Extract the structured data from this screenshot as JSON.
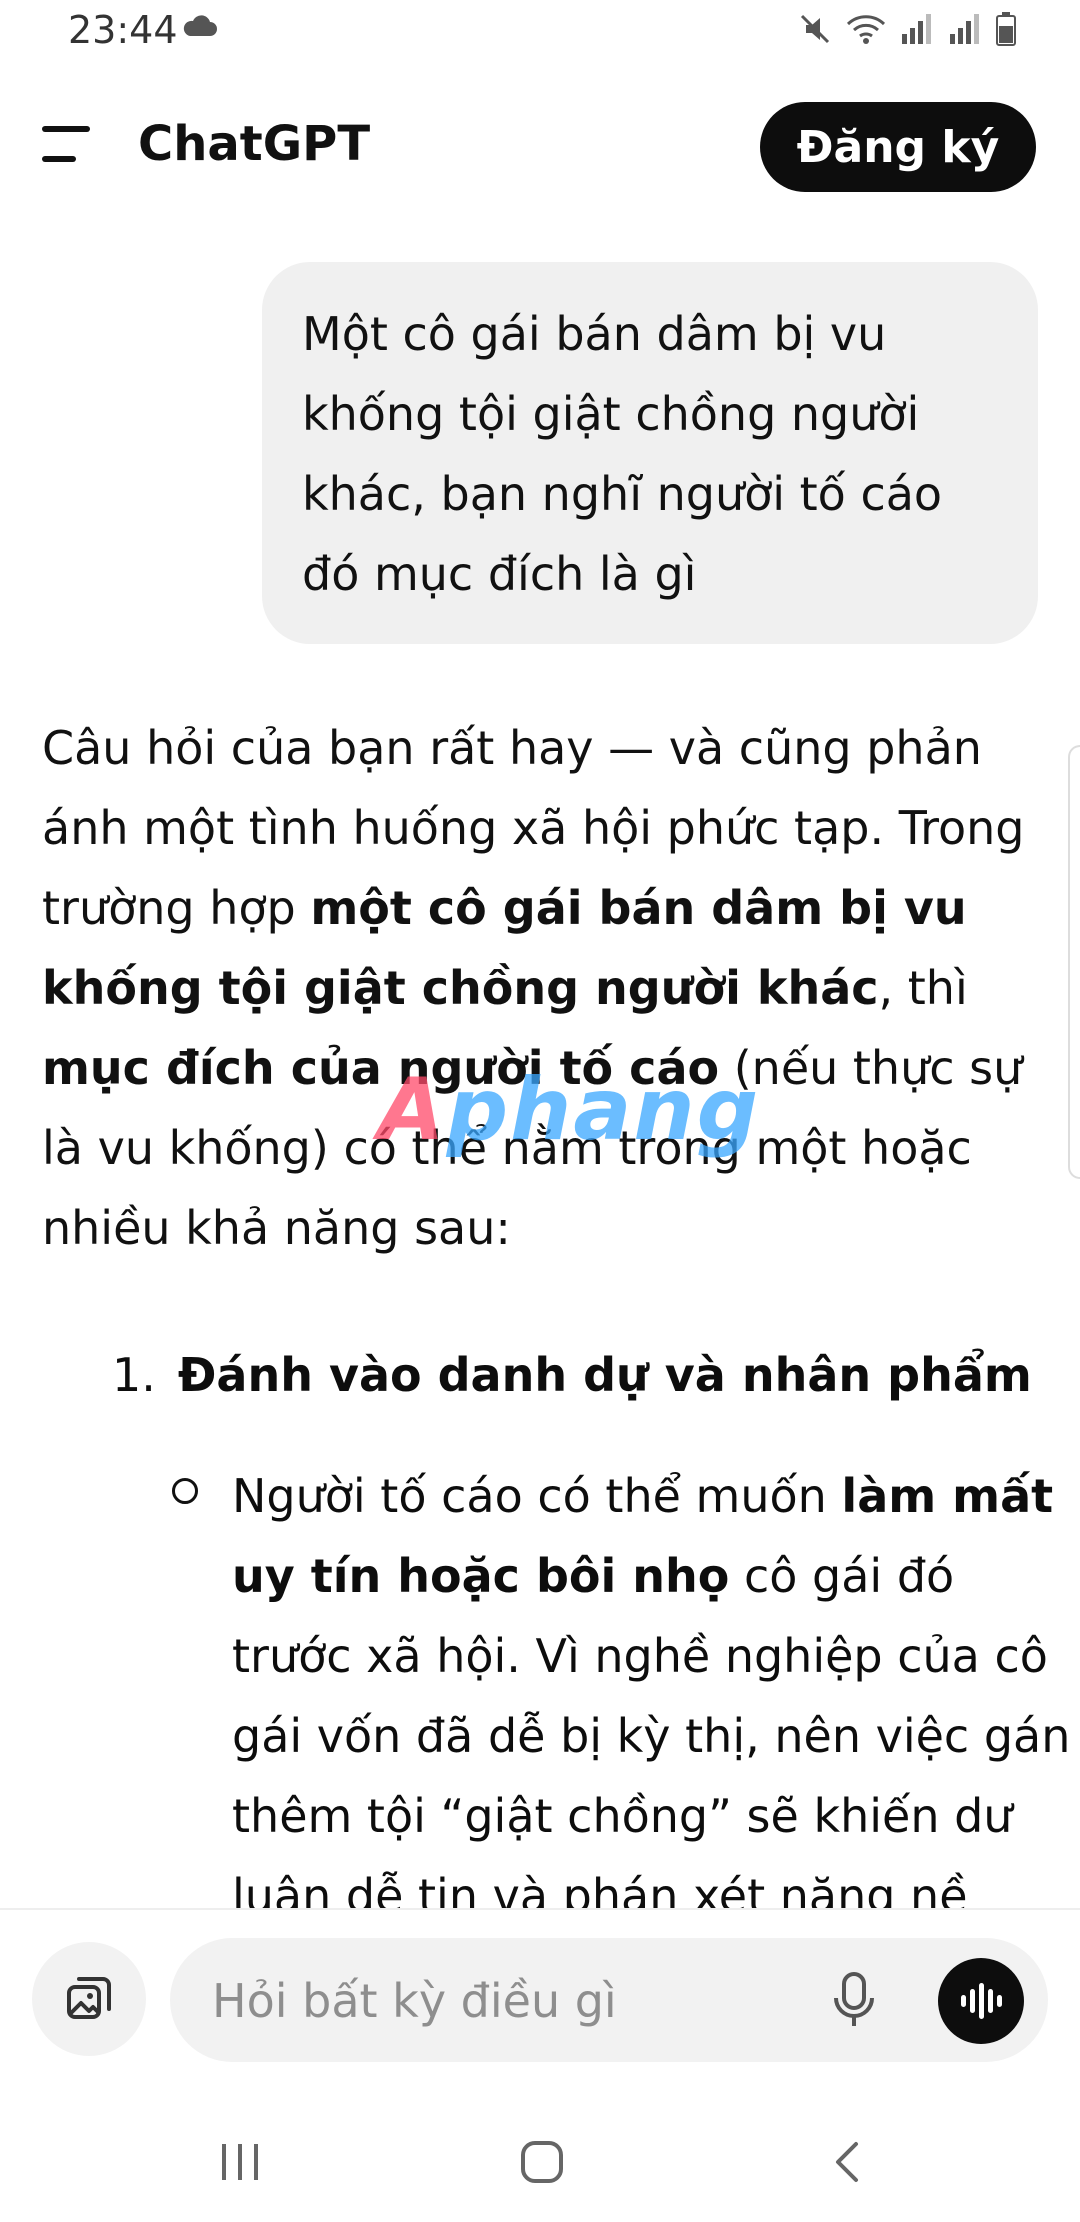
{
  "status_bar": {
    "time": "23:44",
    "icons": [
      "cloud-icon",
      "mute-icon",
      "wifi-icon",
      "signal-icon",
      "signal-icon",
      "battery-icon"
    ]
  },
  "header": {
    "title": "ChatGPT",
    "signup_label": "Đăng ký"
  },
  "user_message": {
    "text": "Một cô gái bán dâm bị vu khống tội giật chồng người khác,  bạn nghĩ người tố cáo đó mục đích là gì"
  },
  "assistant_message": {
    "intro_1": "Câu hỏi của bạn rất hay — và cũng phản ánh một tình huống xã hội phức tạp. Trong trường hợp ",
    "intro_bold_1": "một cô gái bán dâm bị vu khống tội giật chồng người khác",
    "intro_2": ", thì ",
    "intro_bold_2": "mục đích của người tố cáo",
    "intro_3": " (nếu thực sự là vu khống) có thể nằm trong một hoặc nhiều khả năng sau:",
    "list": [
      {
        "number": "1.",
        "title": "Đánh vào danh dự và nhân phẩm",
        "bullet_1": "Người tố cáo có thể muốn ",
        "bullet_bold": "làm mất uy tín hoặc bôi nhọ",
        "bullet_2": " cô gái đó trước xã hội. Vì nghề nghiệp của cô gái vốn đã dễ bị kỳ thị, nên việc gán thêm tội “giật chồng” sẽ khiến dư luận dễ tin và phán xét nặng nề"
      }
    ]
  },
  "watermark": {
    "first": "A",
    "rest": "phang"
  },
  "composer": {
    "placeholder": "Hỏi bất kỳ điều gì"
  },
  "colors": {
    "accent": "#0d0d0d",
    "bubble": "#f0f0f0",
    "placeholder": "#8e8e8e"
  }
}
